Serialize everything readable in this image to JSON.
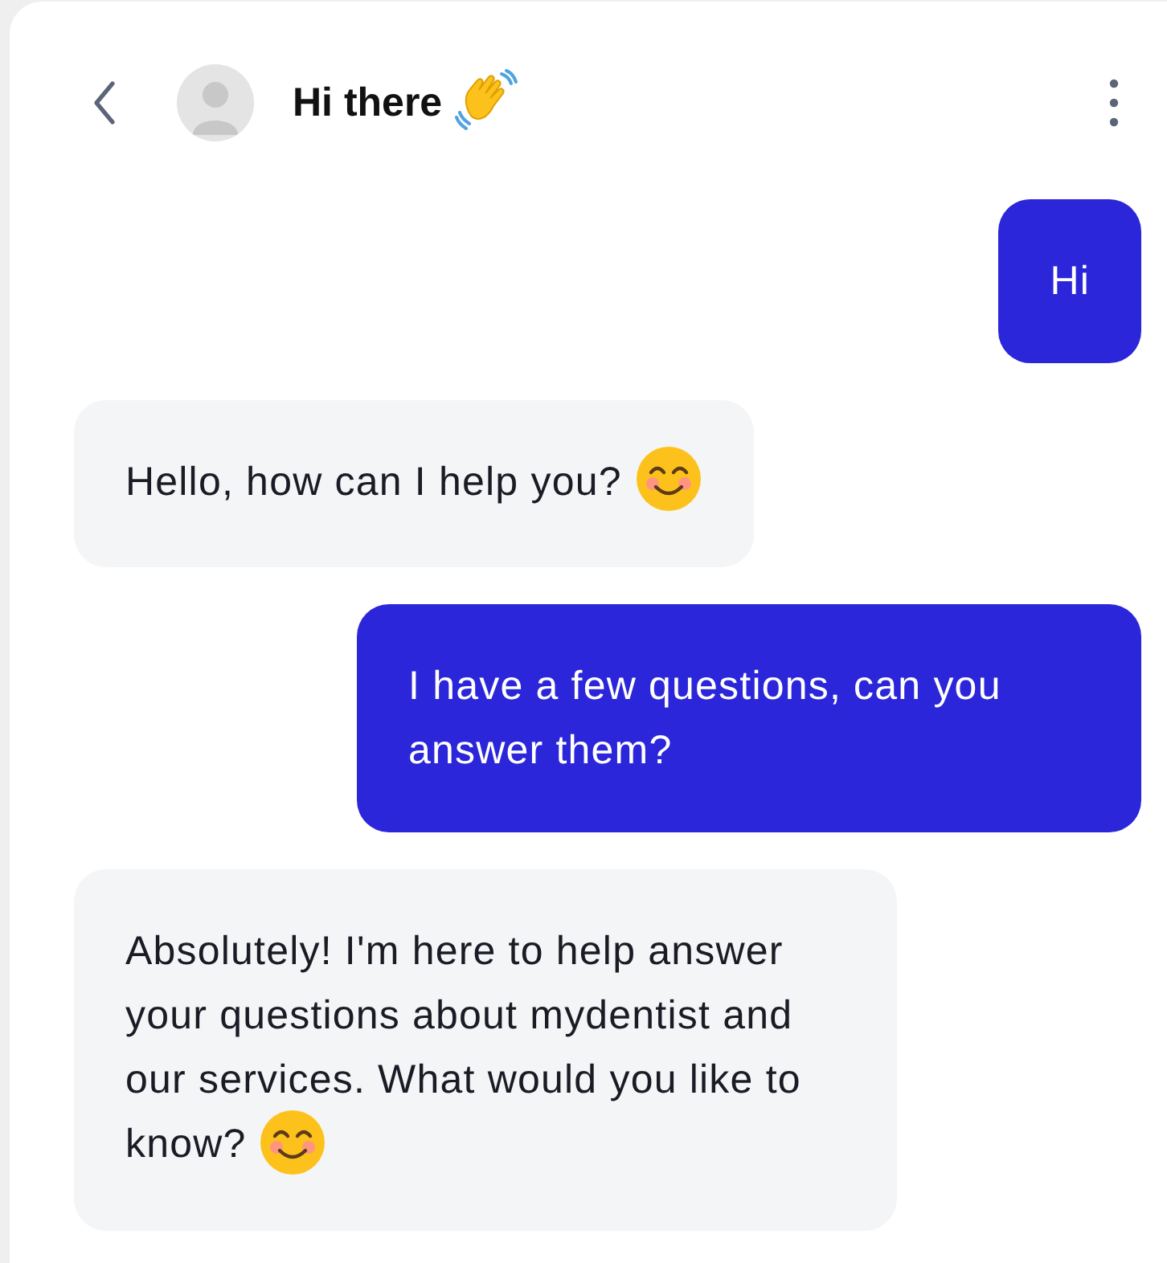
{
  "header": {
    "title": "Hi there",
    "emoji": true
  },
  "messages": [
    {
      "kind": "sent",
      "text": "Hi",
      "emoji": false
    },
    {
      "kind": "received",
      "text": "Hello, how can I help you?",
      "emoji": true
    },
    {
      "kind": "sent",
      "text": "I have a few questions, can you answer them?",
      "emoji": false
    },
    {
      "kind": "received",
      "text": "Absolutely! I'm here to help answer your questions about mydentist and our services. What would you like to know?",
      "emoji": true
    }
  ]
}
